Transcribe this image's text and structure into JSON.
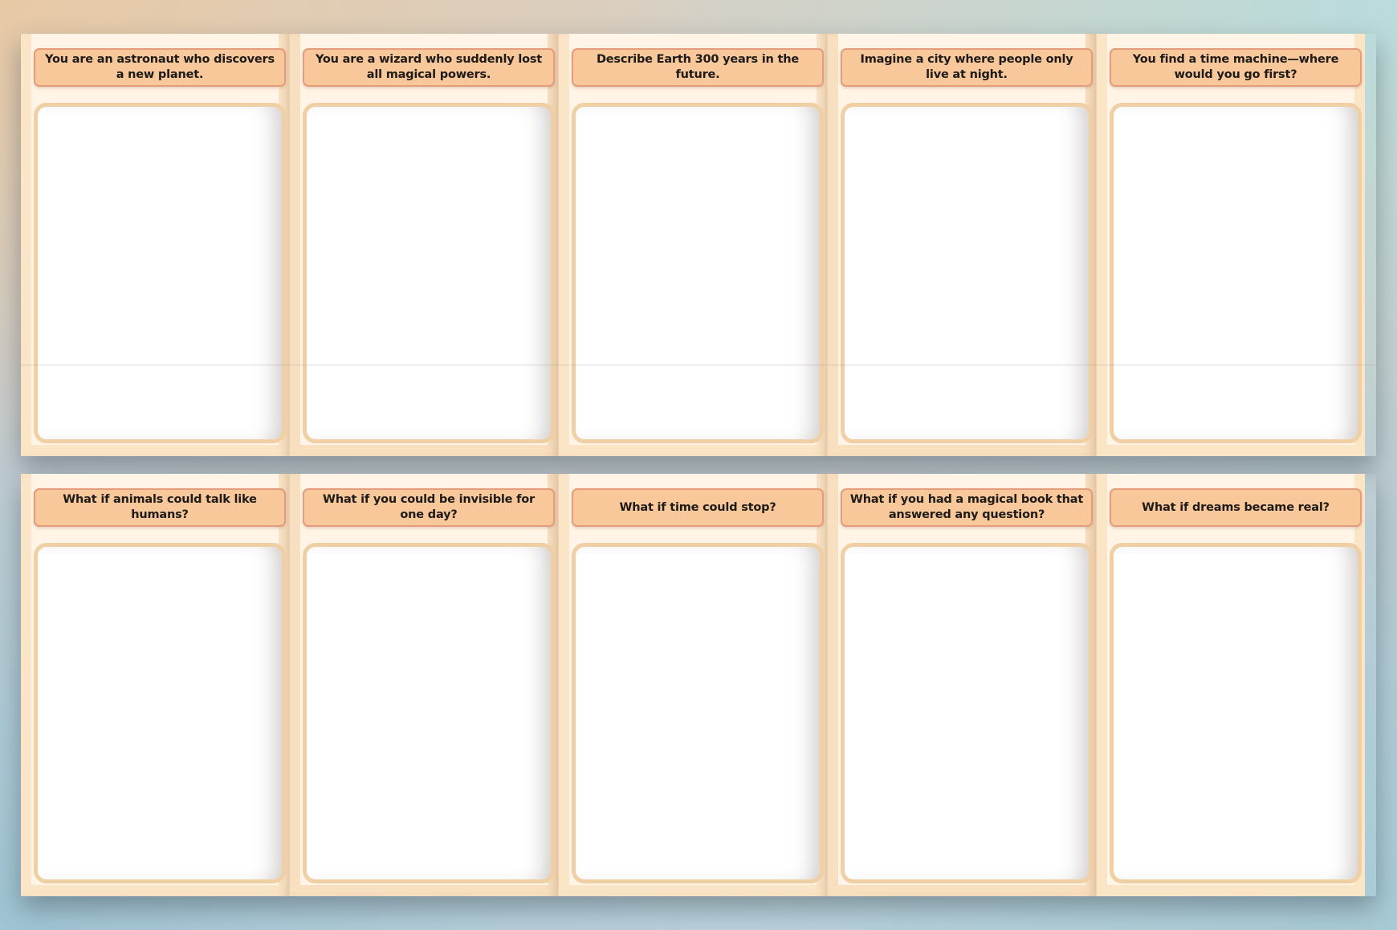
{
  "rows": [
    {
      "cards": [
        {
          "prompt": "You are an astronaut who discovers a new planet."
        },
        {
          "prompt": "You are a wizard who suddenly lost all magical powers."
        },
        {
          "prompt": "Describe Earth 300 years in the future."
        },
        {
          "prompt": "Imagine a city where people only live at night."
        },
        {
          "prompt": "You find a time machine—where would you go first?"
        }
      ]
    },
    {
      "cards": [
        {
          "prompt": "What if animals could talk like humans?"
        },
        {
          "prompt": "What if you could be invisible for one day?"
        },
        {
          "prompt": "What if time could stop?"
        },
        {
          "prompt": "What if you had a magical book that answered any question?"
        },
        {
          "prompt": "What if dreams became real?"
        }
      ]
    }
  ],
  "colors": {
    "card_bg": "#fbe5c7",
    "prompt_bg": "#f8c89a",
    "prompt_border": "#e49c7c",
    "box_border": "#efcfa3"
  }
}
